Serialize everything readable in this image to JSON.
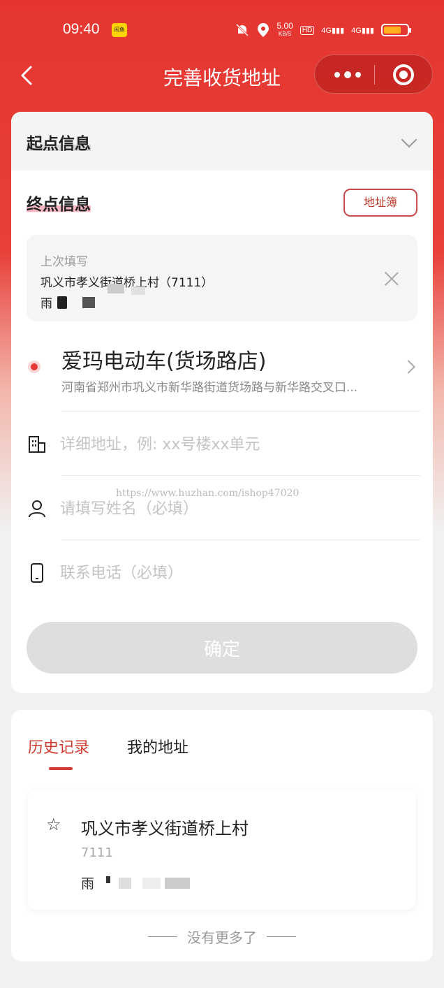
{
  "status_bar": {
    "time": "09:40",
    "app_badge": "闲鱼",
    "speed": "5.00",
    "speed_unit": "KB/S",
    "hd": "HD",
    "signal1": "4G",
    "signal2": "4G",
    "battery_level": 0.75
  },
  "nav": {
    "title": "完善收货地址"
  },
  "form": {
    "start_title": "起点信息",
    "end_title": "终点信息",
    "address_book_label": "地址簿",
    "last_filled_label": "上次填写",
    "last_filled_address": "巩义市孝义街道桥上村（7111）",
    "last_filled_name": "雨",
    "place_name": "爱玛电动车(货场路店)",
    "place_address": "河南省郑州市巩义市新华路街道货场路与新华路交叉口...",
    "detail_placeholder": "详细地址，例: xx号楼xx单元",
    "name_placeholder": "请填写姓名（必填）",
    "phone_placeholder": "联系电话（必填）",
    "confirm_label": "确定"
  },
  "watermark": "https://www.huzhan.com/ishop47020",
  "history": {
    "tabs": [
      "历史记录",
      "我的地址"
    ],
    "record": {
      "title": "巩义市孝义街道桥上村",
      "code": "7111",
      "name": "雨"
    },
    "no_more": "没有更多了"
  },
  "colors": {
    "accent": "#d23b32",
    "header_red": "#e63530"
  }
}
